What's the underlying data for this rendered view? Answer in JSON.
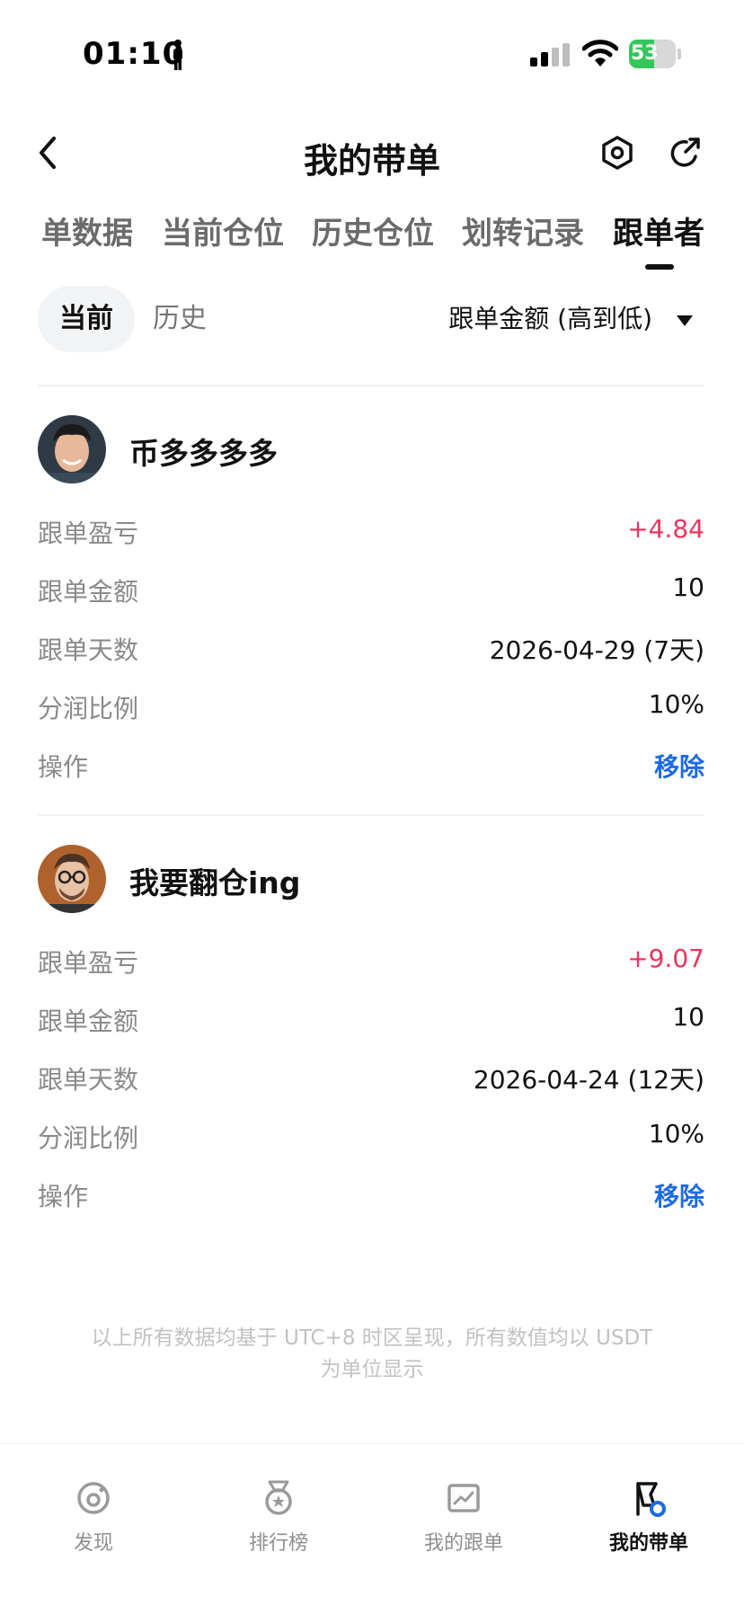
{
  "status_bar": {
    "time": "01:10",
    "battery": "53",
    "battery_level": 0.53
  },
  "header": {
    "title": "我的带单"
  },
  "tabs": [
    {
      "label": "单数据"
    },
    {
      "label": "当前仓位"
    },
    {
      "label": "历史仓位"
    },
    {
      "label": "划转记录"
    },
    {
      "label": "跟单者",
      "active": true
    }
  ],
  "filter": {
    "current_label": "当前",
    "history_label": "历史",
    "sort_label": "跟单金额 (高到低)"
  },
  "followers": [
    {
      "name": "币多多多多",
      "avatar": "avatar-man-smiling",
      "rows": [
        {
          "label": "跟单盈亏",
          "value": "+4.84",
          "style": "pos"
        },
        {
          "label": "跟单金额",
          "value": "10",
          "style": ""
        },
        {
          "label": "跟单天数",
          "value": "2026-04-29 (7天)",
          "style": ""
        },
        {
          "label": "分润比例",
          "value": "10%",
          "style": ""
        },
        {
          "label": "操作",
          "value": "移除",
          "style": "action"
        }
      ]
    },
    {
      "name": "我要翻仓ing",
      "avatar": "avatar-man-glasses",
      "rows": [
        {
          "label": "跟单盈亏",
          "value": "+9.07",
          "style": "pos"
        },
        {
          "label": "跟单金额",
          "value": "10",
          "style": ""
        },
        {
          "label": "跟单天数",
          "value": "2026-04-24 (12天)",
          "style": ""
        },
        {
          "label": "分润比例",
          "value": "10%",
          "style": ""
        },
        {
          "label": "操作",
          "value": "移除",
          "style": "action"
        }
      ]
    }
  ],
  "footnote": "以上所有数据均基于 UTC+8 时区呈现，所有数值均以 USDT 为单位显示",
  "bottom_nav": [
    {
      "label": "发现",
      "icon": "discover-icon"
    },
    {
      "label": "排行榜",
      "icon": "ranking-medal-icon"
    },
    {
      "label": "我的跟单",
      "icon": "my-copy-chart-icon"
    },
    {
      "label": "我的带单",
      "icon": "my-lead-flag-icon",
      "active": true
    }
  ],
  "colors": {
    "positive": "#e8365d",
    "action": "#1d6ae5",
    "battery": "#34c759",
    "accent_blue": "#1d6ae5"
  }
}
